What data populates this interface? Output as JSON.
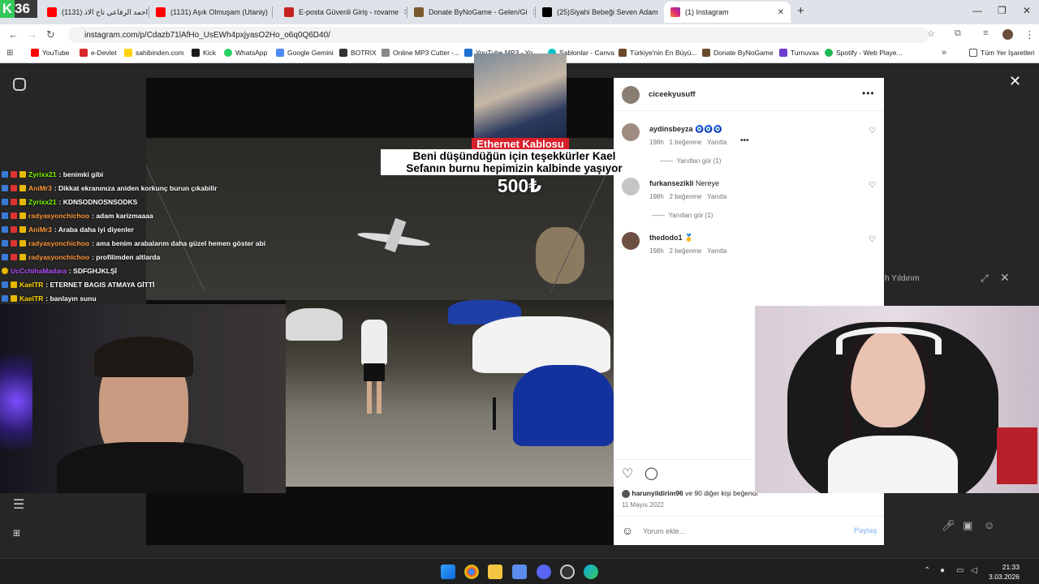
{
  "browser": {
    "tabs": [
      {
        "label": "(1131) سيد احمد الرفاعي تاج الاذ",
        "color": "#ff0000"
      },
      {
        "label": "(1131) Aşık Olmuşam (Utaniy)",
        "color": "#ff0000"
      },
      {
        "label": "E-posta Güvenli Giriş - rovame",
        "color": "#c5221f"
      },
      {
        "label": "Donate ByNoGame - Gelen/Gi",
        "color": "#333333"
      },
      {
        "label": "(25)Siyahi Bebeği Seven Adam",
        "color": "#000000"
      },
      {
        "label": "(1) Instagram",
        "color": "#d6249f"
      }
    ],
    "url": "instagram.com/p/Cdazb71lAfHo_UsEWh4pxjyasO2Ho_o6q0Q6D40/",
    "bookmarks": [
      "YouTube",
      "e-Devlet",
      "sahibinden.com",
      "Kick",
      "WhatsApp",
      "Google Gemini",
      "BOTRIX",
      "Online MP3 Cutter -...",
      "YouTube MP3 - Yo",
      "Şablonlar - Canva",
      "Türkiye'nin En Büyü...",
      "Donate ByNoGame",
      "Turnuvax",
      "Spotify - Web Playe..."
    ],
    "all_bookmarks": "Tüm Yer İşaretleri"
  },
  "stream": {
    "logo_number": "36",
    "chat": [
      {
        "user": "Zyrixx21",
        "text": ": benimki gibi",
        "color": "#7CFC00"
      },
      {
        "user": "AniMr3",
        "text": ": Dikkat ekranınıza aniden korkunç burun çıkabilir",
        "color": "#ff9a3c"
      },
      {
        "user": "Zyrixx21",
        "text": ": KDNSODNOSNSODKS",
        "color": "#7CFC00"
      },
      {
        "user": "radyasyonchichoo",
        "text": ": adam karizmaaaa",
        "color": "#ff9a3c"
      },
      {
        "user": "AniMr3",
        "text": ": Araba daha iyi diyenler",
        "color": "#ff9a3c"
      },
      {
        "user": "radyasyonchichoo",
        "text": ": ama benim arabalarım daha güzel hemen göster abi",
        "color": "#ff9a3c"
      },
      {
        "user": "radyasyonchichoo",
        "text": ": profilimden altlarda",
        "color": "#ff9a3c"
      },
      {
        "user": "UcCchihaMadara",
        "text": ": SDFGHJKLŞİ",
        "color": "#b44dff"
      },
      {
        "user": "KaelTR",
        "text": ": ETERNET BAGIS ATMAYA GİTTİ",
        "color": "#ffd700"
      },
      {
        "user": "KaelTR",
        "text": ": banlayın sunu",
        "color": "#ffd700"
      }
    ],
    "donation": {
      "title": "Ethernet Kablosu",
      "message_line1": "Beni düşündüğün için teşekkürler Kael",
      "message_line2": "Sefanın burnu hepimizin kalbinde yaşıyor",
      "amount": "500₺"
    },
    "side_snippet": "h Yıldırım"
  },
  "instagram": {
    "author": "ciceekyusuff",
    "comments": [
      {
        "user": "aydinsbeyza",
        "text": "",
        "age": "198h",
        "likes": "1 beğenme",
        "reply": "Yanıtla",
        "view_replies": "Yanıtları gör (1)",
        "emoji": "🧿🧿🧿"
      },
      {
        "user": "furkansezikli",
        "text": "Nereye",
        "age": "198h",
        "likes": "2 beğenme",
        "reply": "Yanıtla",
        "view_replies": "Yanıtları gör (1)",
        "emoji": ""
      },
      {
        "user": "thedodo1",
        "text": "",
        "age": "198h",
        "likes": "2 beğenme",
        "reply": "Yanıtla",
        "view_replies": "",
        "emoji": "🥇"
      }
    ],
    "liked_by_user": "harunyildirim96",
    "liked_by_rest": "ve 90 diğer kişi beğendi",
    "date": "11 Mayıs 2022",
    "comment_placeholder": "Yorum ekle...",
    "share_label": "Paylaş"
  },
  "taskbar": {
    "time": "21:33",
    "date": "3.03.2026"
  }
}
